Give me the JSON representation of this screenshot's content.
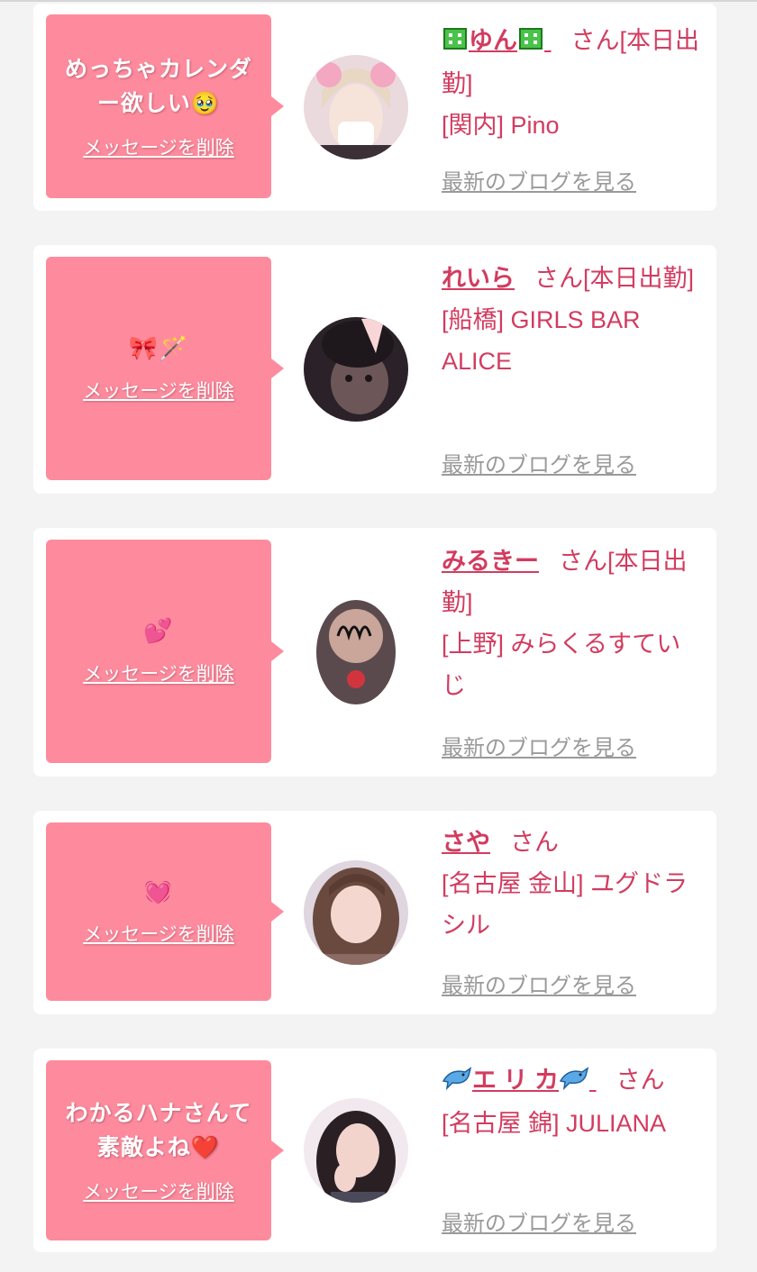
{
  "delete_label": "メッセージを削除",
  "blog_label": "最新のブログを見る",
  "cards": [
    {
      "message": "めっちゃカレンダー欲しい🥹",
      "name": "ゆん",
      "name_icon": "office-building-icon",
      "san_label": "さん[本日出勤]",
      "shop": "[関内] Pino"
    },
    {
      "message": "🎀🪄",
      "name": "れいら",
      "san_label": "さん[本日出勤]",
      "shop": "[船橋] GIRLS BAR ALICE"
    },
    {
      "message": "💕",
      "name": "みるきー",
      "san_label": "さん[本日出勤]",
      "shop": "[上野] みらくるすていじ"
    },
    {
      "message": "💓",
      "name": "さや",
      "san_label": "さん",
      "shop": "[名古屋 金山] ユグドラシル"
    },
    {
      "message": "わかるハナさんて素敵よね❤️",
      "name": "エ リ カ",
      "name_icon": "dolphin-icon",
      "san_label": "さん",
      "shop": "[名古屋 錦] JULIANA"
    }
  ],
  "colors": {
    "bubble": "#fd8b9d",
    "accent": "#d23c60",
    "muted_link": "#9a9a9a",
    "background": "#f3f3f3"
  }
}
